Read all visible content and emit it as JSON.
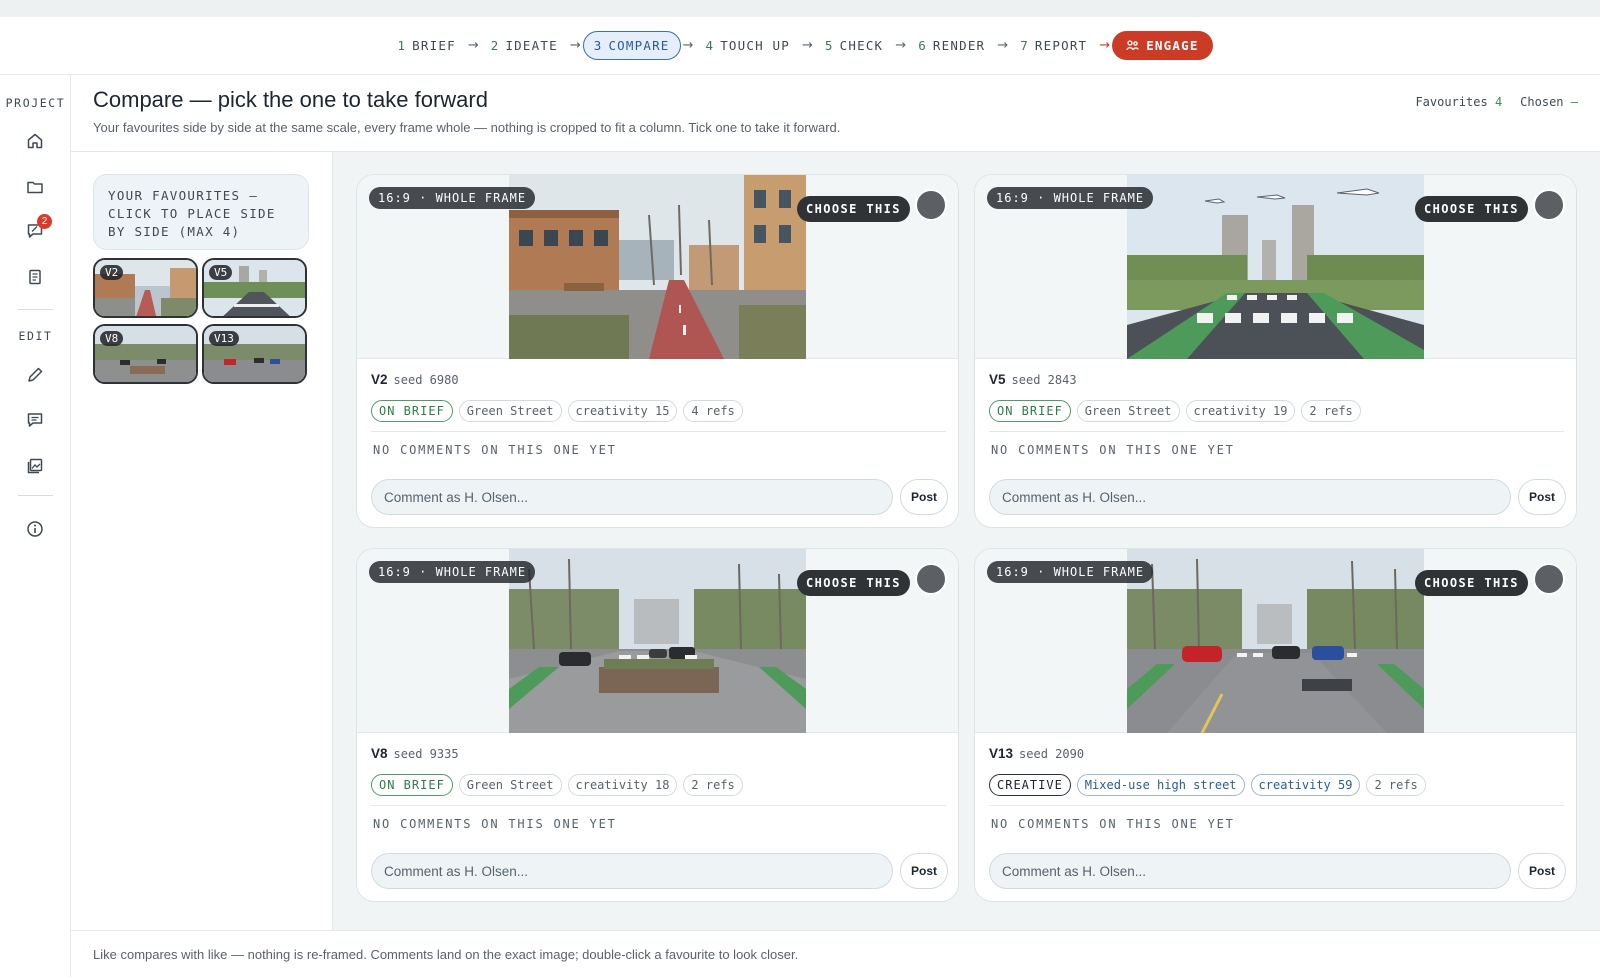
{
  "stepper": {
    "steps": [
      {
        "num": "1",
        "label": "BRIEF"
      },
      {
        "num": "2",
        "label": "IDEATE"
      },
      {
        "num": "3",
        "label": "COMPARE"
      },
      {
        "num": "4",
        "label": "TOUCH UP"
      },
      {
        "num": "5",
        "label": "CHECK"
      },
      {
        "num": "6",
        "label": "RENDER"
      },
      {
        "num": "7",
        "label": "REPORT"
      }
    ],
    "engage_label": "ENGAGE",
    "active_step": "3",
    "arrow": "→"
  },
  "sidebar": {
    "project_label": "PROJECT",
    "edit_label": "EDIT",
    "feedback_badge": "2",
    "icons": [
      "home-icon",
      "folder-icon",
      "feedback-icon",
      "document-icon",
      "pencil-icon",
      "comment-icon",
      "gallery-icon",
      "info-icon"
    ]
  },
  "header": {
    "title": "Compare — pick the one to take forward",
    "subtitle": "Your favourites side by side at the same scale, every frame whole — nothing is cropped to fit a column. Tick one to take it forward.",
    "favourites_label": "Favourites",
    "favourites_count": "4",
    "chosen_label": "Chosen",
    "chosen_value": "—"
  },
  "favourites_panel": {
    "note": "YOUR FAVOURITES — CLICK TO PLACE SIDE BY SIDE (MAX 4)",
    "thumbs": [
      "V2",
      "V5",
      "V8",
      "V13"
    ]
  },
  "cards": [
    {
      "id": "V2",
      "seed_label": "seed 6980",
      "frame_tag": "16:9 · WHOLE FRAME",
      "choose_label": "CHOOSE THIS",
      "tags": [
        "ON BRIEF",
        "Green Street",
        "creativity 15",
        "4 refs"
      ],
      "no_comments": "NO COMMENTS ON THIS ONE YET",
      "comment_placeholder": "Comment as H. Olsen...",
      "post_label": "Post"
    },
    {
      "id": "V5",
      "seed_label": "seed 2843",
      "frame_tag": "16:9 · WHOLE FRAME",
      "choose_label": "CHOOSE THIS",
      "tags": [
        "ON BRIEF",
        "Green Street",
        "creativity 19",
        "2 refs"
      ],
      "no_comments": "NO COMMENTS ON THIS ONE YET",
      "comment_placeholder": "Comment as H. Olsen...",
      "post_label": "Post"
    },
    {
      "id": "V8",
      "seed_label": "seed 9335",
      "frame_tag": "16:9 · WHOLE FRAME",
      "choose_label": "CHOOSE THIS",
      "tags": [
        "ON BRIEF",
        "Green Street",
        "creativity 18",
        "2 refs"
      ],
      "no_comments": "NO COMMENTS ON THIS ONE YET",
      "comment_placeholder": "Comment as H. Olsen...",
      "post_label": "Post"
    },
    {
      "id": "V13",
      "seed_label": "seed 2090",
      "frame_tag": "16:9 · WHOLE FRAME",
      "choose_label": "CHOOSE THIS",
      "tags": [
        "CREATIVE",
        "Mixed-use high street",
        "creativity 59",
        "2 refs"
      ],
      "no_comments": "NO COMMENTS ON THIS ONE YET",
      "comment_placeholder": "Comment as H. Olsen...",
      "post_label": "Post"
    }
  ],
  "footer": {
    "text": "Like compares with like — nothing is re-framed. Comments land on the exact image; double-click a favourite to look closer."
  },
  "colors": {
    "accent_blue": "#3b6fb8",
    "engage_red": "#cc3b25",
    "on_brief_green": "#2e7d47",
    "badge_red": "#d93a2a"
  }
}
